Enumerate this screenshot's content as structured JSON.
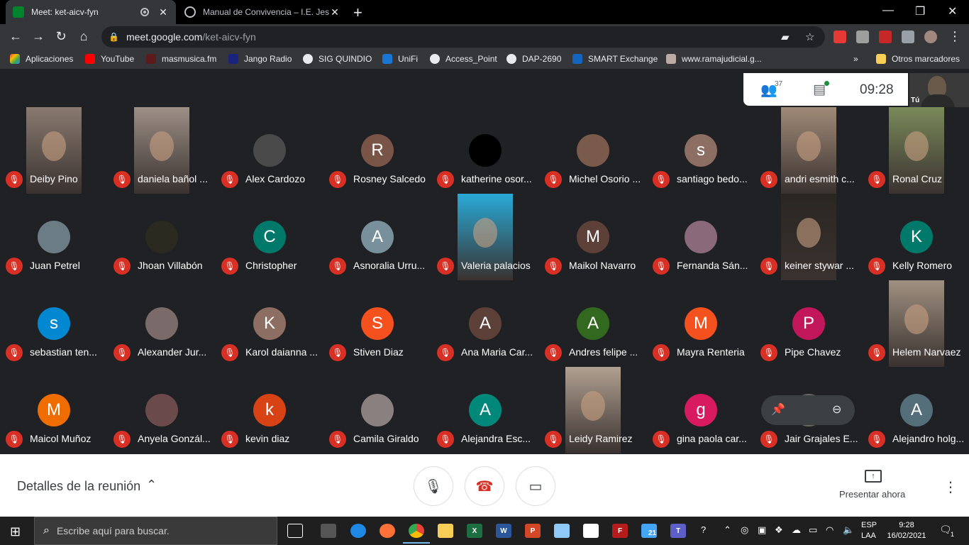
{
  "browser": {
    "tabs": [
      {
        "title": "Meet: ket-aicv-fyn",
        "active": true
      },
      {
        "title": "Manual de Convivencia – I.E. Jesú",
        "active": false
      }
    ],
    "url_host": "meet.google.com",
    "url_path": "/ket-aicv-fyn",
    "bookmarks": [
      "Aplicaciones",
      "YouTube",
      "masmusica.fm",
      "Jango Radio",
      "SIG QUINDIO",
      "UniFi",
      "Access_Point",
      "DAP-2690",
      "SMART Exchange",
      "www.ramajudicial.g..."
    ],
    "bookmarks_more": "»",
    "other_bookmarks": "Otros marcadores"
  },
  "meeting": {
    "participant_count": "37",
    "time": "09:28",
    "self_label": "Tú",
    "participants": [
      {
        "name": "Deiby Pino",
        "kind": "video",
        "color": "#8a7a70"
      },
      {
        "name": "daniela bañol ...",
        "kind": "video",
        "color": "#9c8f86"
      },
      {
        "name": "Alex Cardozo",
        "kind": "photo",
        "color": "#4a4a4a"
      },
      {
        "name": "Rosney Salcedo",
        "kind": "letter",
        "letter": "R",
        "color": "#795548"
      },
      {
        "name": "katherine osor...",
        "kind": "photo",
        "color": "#000000"
      },
      {
        "name": "Michel Osorio ...",
        "kind": "photo",
        "color": "#7a5a4a"
      },
      {
        "name": "santiago bedo...",
        "kind": "letter",
        "letter": "s",
        "color": "#8d6e63"
      },
      {
        "name": "andri esmith c...",
        "kind": "video",
        "color": "#a08a78"
      },
      {
        "name": "Ronal Cruz",
        "kind": "video",
        "color": "#7a8a5a"
      },
      {
        "name": "Juan Petrel",
        "kind": "photo",
        "color": "#6b7c85"
      },
      {
        "name": "Jhoan Villabón",
        "kind": "photo",
        "color": "#2a2a20"
      },
      {
        "name": "Christopher",
        "kind": "letter",
        "letter": "C",
        "color": "#00796b"
      },
      {
        "name": "Asnoralia Urru...",
        "kind": "letter",
        "letter": "A",
        "color": "#78909c"
      },
      {
        "name": "Valeria palacios",
        "kind": "video",
        "color": "#29a9d6"
      },
      {
        "name": "Maikol Navarro",
        "kind": "letter",
        "letter": "M",
        "color": "#5d4037"
      },
      {
        "name": "Fernanda Sán...",
        "kind": "photo",
        "color": "#8a6a7a"
      },
      {
        "name": "keiner stywar ...",
        "kind": "video",
        "color": "#2a2622"
      },
      {
        "name": "Kelly Romero",
        "kind": "letter",
        "letter": "K",
        "color": "#00796b"
      },
      {
        "name": "sebastian ten...",
        "kind": "letter",
        "letter": "s",
        "color": "#0288d1"
      },
      {
        "name": "Alexander Jur...",
        "kind": "photo",
        "color": "#7a6a6a"
      },
      {
        "name": "Karol daianna ...",
        "kind": "letter",
        "letter": "K",
        "color": "#8d6e63"
      },
      {
        "name": "Stiven Diaz",
        "kind": "letter",
        "letter": "S",
        "color": "#f4511e"
      },
      {
        "name": "Ana Maria Car...",
        "kind": "letter",
        "letter": "A",
        "color": "#5d4037"
      },
      {
        "name": "Andres felipe ...",
        "kind": "letter",
        "letter": "A",
        "color": "#33691e"
      },
      {
        "name": "Mayra Renteria",
        "kind": "letter",
        "letter": "M",
        "color": "#f4511e"
      },
      {
        "name": "Pipe Chavez",
        "kind": "letter",
        "letter": "P",
        "color": "#c2185b"
      },
      {
        "name": "Helem Narvaez",
        "kind": "video",
        "color": "#a09080"
      },
      {
        "name": "Maicol Muñoz",
        "kind": "letter",
        "letter": "M",
        "color": "#ef6c00"
      },
      {
        "name": "Anyela Gonzál...",
        "kind": "photo",
        "color": "#6a4a4a"
      },
      {
        "name": "kevin diaz",
        "kind": "letter",
        "letter": "k",
        "color": "#d84315"
      },
      {
        "name": "Camila Giraldo",
        "kind": "photo",
        "color": "#8a8080"
      },
      {
        "name": "Alejandra Esc...",
        "kind": "letter",
        "letter": "A",
        "color": "#00897b"
      },
      {
        "name": "Leidy Ramirez",
        "kind": "video",
        "color": "#b0a090"
      },
      {
        "name": "gina paola car...",
        "kind": "letter",
        "letter": "g",
        "color": "#d81b60"
      },
      {
        "name": "Jair Grajales E...",
        "kind": "photo",
        "color": "#6a6a60"
      },
      {
        "name": "Alejandro holg...",
        "kind": "letter",
        "letter": "A",
        "color": "#546e7a"
      }
    ]
  },
  "bottom_bar": {
    "details_label": "Detalles de la reunión",
    "present_label": "Presentar ahora"
  },
  "taskbar": {
    "search_placeholder": "Escribe aquí para buscar.",
    "lang_1": "ESP",
    "lang_2": "LAA",
    "time": "9:28",
    "date": "16/02/2021",
    "notification_count": "1",
    "folder_badge": "21"
  }
}
